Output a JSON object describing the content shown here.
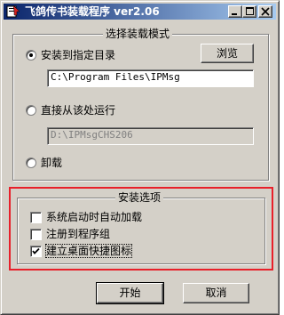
{
  "window": {
    "title": "飞鸽传书装载程序 ver2.06"
  },
  "titlebar_buttons": {
    "minimize_icon": "minimize-icon",
    "maximize_icon": "maximize-icon",
    "close_icon": "close-icon"
  },
  "install_mode": {
    "title": "选择装载模式",
    "browse_label": "浏览",
    "options": [
      {
        "label": "安装到指定目录",
        "checked": true
      },
      {
        "label": "直接从该处运行",
        "checked": false
      },
      {
        "label": "卸载",
        "checked": false
      }
    ],
    "install_dir": "C:\\Program Files\\IPMsg",
    "run_dir": "D:\\IPMsgCHS206"
  },
  "install_options": {
    "title": "安装选项",
    "items": [
      {
        "label": "系统启动时自动加载",
        "checked": false
      },
      {
        "label": "注册到程序组",
        "checked": false
      },
      {
        "label": "建立桌面快捷图标",
        "checked": true
      }
    ]
  },
  "actions": {
    "start_label": "开始",
    "cancel_label": "取消"
  },
  "colors": {
    "highlight": "#e8202a",
    "title_gradient_start": "#0a246a",
    "title_gradient_end": "#a6caf0",
    "face": "#d4d0c8"
  }
}
